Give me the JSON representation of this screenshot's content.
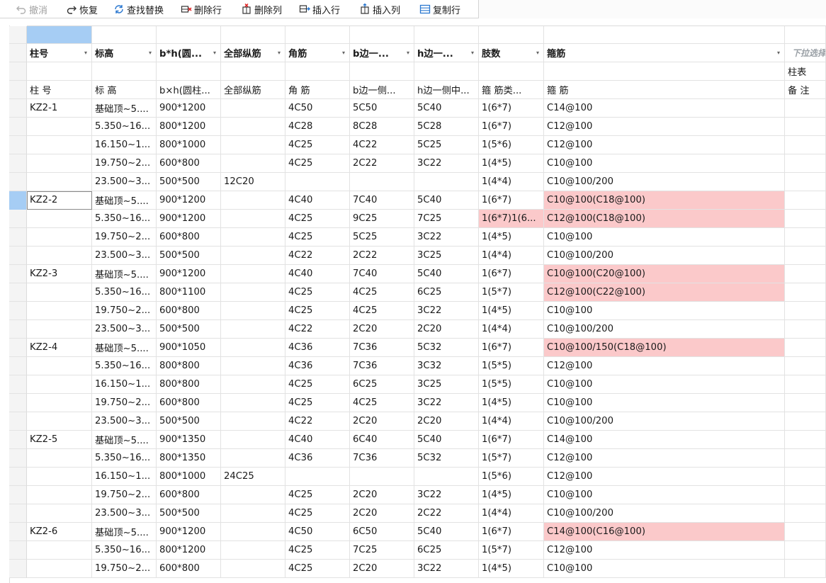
{
  "toolbar": {
    "undo": "撤消",
    "redo": "恢复",
    "find_replace": "查找替换",
    "delete_row": "删除行",
    "delete_col": "删除列",
    "insert_row": "插入行",
    "insert_col": "插入列",
    "copy_row": "复制行"
  },
  "header": {
    "columns": [
      "柱号",
      "标高",
      "b*h(圆...",
      "全部纵筋",
      "角筋",
      "b边一...",
      "h边一...",
      "肢数",
      "箍筋"
    ],
    "extra_hint": "下拉选择",
    "sub_label": "柱表"
  },
  "label_row": [
    "柱 号",
    "标 高",
    "b×h(圆柱...",
    "全部纵筋",
    "角 筋",
    "b边一侧...",
    "h边一侧中...",
    "箍 筋类...",
    "箍 筋",
    "备 注"
  ],
  "rows": [
    [
      "KZ2-1",
      "基础顶~5....",
      "900*1200",
      "",
      "4C50",
      "5C50",
      "5C40",
      "1(6*7)",
      "C14@100"
    ],
    [
      "",
      "5.350~16...",
      "800*1200",
      "",
      "4C28",
      "8C28",
      "5C28",
      "1(6*7)",
      "C12@100"
    ],
    [
      "",
      "16.150~1...",
      "800*1000",
      "",
      "4C25",
      "4C22",
      "5C25",
      "1(5*6)",
      "C12@100"
    ],
    [
      "",
      "19.750~2...",
      "600*800",
      "",
      "4C25",
      "2C22",
      "3C22",
      "1(4*5)",
      "C10@100"
    ],
    [
      "",
      "23.500~3...",
      "500*500",
      "12C20",
      "",
      "",
      "",
      "1(4*4)",
      "C10@100/200"
    ],
    [
      "KZ2-2",
      "基础顶~5....",
      "900*1200",
      "",
      "4C40",
      "7C40",
      "5C40",
      "1(6*7)",
      "C10@100(C18@100)"
    ],
    [
      "",
      "5.350~16...",
      "900*1200",
      "",
      "4C25",
      "9C25",
      "7C25",
      "1(6*7)1(6...",
      "C12@100(C18@100)"
    ],
    [
      "",
      "19.750~2...",
      "600*800",
      "",
      "4C25",
      "5C25",
      "3C22",
      "1(4*5)",
      "C10@100"
    ],
    [
      "",
      "23.500~3...",
      "500*500",
      "",
      "4C22",
      "2C22",
      "3C25",
      "1(4*4)",
      "C10@100/200"
    ],
    [
      "KZ2-3",
      "基础顶~5....",
      "900*1200",
      "",
      "4C40",
      "7C40",
      "5C40",
      "1(6*7)",
      "C10@100(C20@100)"
    ],
    [
      "",
      "5.350~16...",
      "800*1100",
      "",
      "4C25",
      "4C25",
      "6C25",
      "1(5*7)",
      "C12@100(C22@100)"
    ],
    [
      "",
      "19.750~2...",
      "600*800",
      "",
      "4C25",
      "4C25",
      "3C22",
      "1(4*5)",
      "C10@100"
    ],
    [
      "",
      "23.500~3...",
      "500*500",
      "",
      "4C22",
      "2C20",
      "2C20",
      "1(4*4)",
      "C10@100/200"
    ],
    [
      "KZ2-4",
      "基础顶~5....",
      "900*1050",
      "",
      "4C36",
      "7C36",
      "5C32",
      "1(6*7)",
      "C10@100/150(C18@100)"
    ],
    [
      "",
      "5.350~16...",
      "800*800",
      "",
      "4C36",
      "7C36",
      "3C32",
      "1(5*5)",
      "C12@100"
    ],
    [
      "",
      "16.150~1...",
      "800*800",
      "",
      "4C25",
      "6C25",
      "3C25",
      "1(5*5)",
      "C10@100"
    ],
    [
      "",
      "19.750~2...",
      "600*800",
      "",
      "4C25",
      "4C25",
      "3C22",
      "1(4*5)",
      "C10@100"
    ],
    [
      "",
      "23.500~3...",
      "500*500",
      "",
      "4C22",
      "2C20",
      "2C20",
      "1(4*4)",
      "C10@100/200"
    ],
    [
      "KZ2-5",
      "基础顶~5....",
      "900*1350",
      "",
      "4C40",
      "6C40",
      "5C40",
      "1(6*7)",
      "C14@100"
    ],
    [
      "",
      "5.350~16...",
      "800*1350",
      "",
      "4C36",
      "7C36",
      "5C32",
      "1(5*7)",
      "C12@100"
    ],
    [
      "",
      "16.150~1...",
      "800*1000",
      "24C25",
      "",
      "",
      "",
      "1(5*6)",
      "C12@100"
    ],
    [
      "",
      "19.750~2...",
      "600*800",
      "",
      "4C25",
      "2C20",
      "3C22",
      "1(4*5)",
      "C10@100"
    ],
    [
      "",
      "23.500~3...",
      "500*500",
      "",
      "4C25",
      "2C20",
      "2C22",
      "1(4*4)",
      "C10@100/200"
    ],
    [
      "KZ2-6",
      "基础顶~5....",
      "900*1200",
      "",
      "4C50",
      "6C50",
      "5C40",
      "1(6*7)",
      "C14@100(C16@100)"
    ],
    [
      "",
      "5.350~16...",
      "800*1200",
      "",
      "4C25",
      "7C25",
      "6C25",
      "1(5*7)",
      "C12@100"
    ],
    [
      "",
      "19.750~2...",
      "600*800",
      "",
      "4C25",
      "2C20",
      "3C22",
      "1(4*5)",
      "C10@100"
    ]
  ],
  "highlighted": [
    [
      5,
      8
    ],
    [
      6,
      7
    ],
    [
      6,
      8
    ],
    [
      9,
      8
    ],
    [
      10,
      8
    ],
    [
      13,
      8
    ],
    [
      23,
      8
    ]
  ],
  "selected_row": 5,
  "colors": {
    "highlight": "#fbc9ca",
    "selection": "#a6cdf4"
  }
}
